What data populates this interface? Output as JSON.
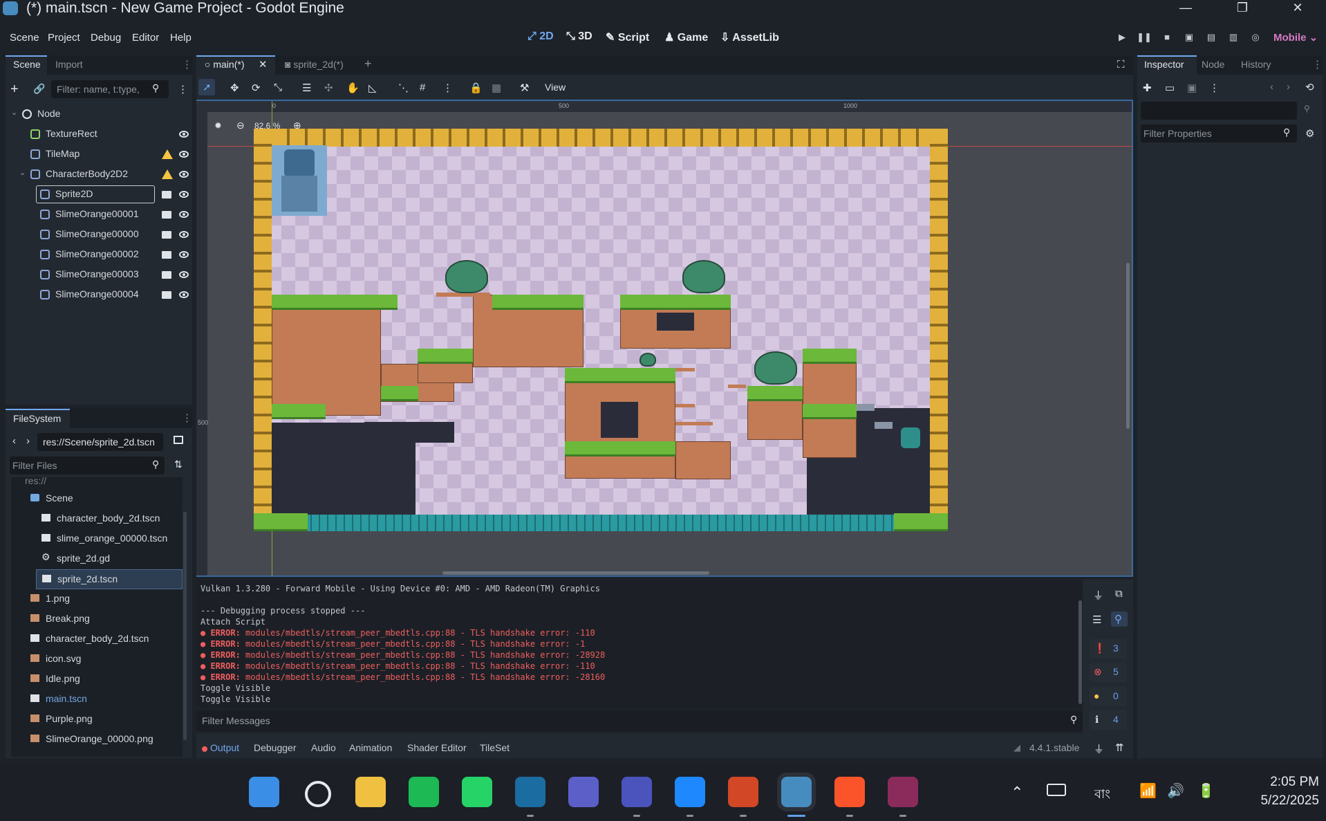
{
  "window": {
    "title": "(*) main.tscn - New Game Project - Godot Engine"
  },
  "menu": [
    "Scene",
    "Project",
    "Debug",
    "Editor",
    "Help"
  ],
  "workspaces": [
    {
      "label": "2D",
      "active": true
    },
    {
      "label": "3D",
      "active": false
    },
    {
      "label": "Script",
      "active": false
    },
    {
      "label": "Game",
      "active": false
    },
    {
      "label": "AssetLib",
      "active": false
    }
  ],
  "renderer": "Mobile",
  "scene_dock": {
    "tabs": [
      "Scene",
      "Import"
    ],
    "filter_placeholder": "Filter: name, t:type,",
    "nodes": [
      {
        "label": "Node",
        "icon": "node-icon"
      },
      {
        "label": "TextureRect",
        "icon": "texture-rect-icon"
      },
      {
        "label": "TileMap",
        "icon": "tilemap-icon",
        "warning": true
      },
      {
        "label": "CharacterBody2D2",
        "icon": "character-body-icon",
        "warning": true
      },
      {
        "label": "Sprite2D",
        "icon": "sprite-icon"
      },
      {
        "label": "SlimeOrange00001",
        "icon": "sprite-icon"
      },
      {
        "label": "SlimeOrange00000",
        "icon": "sprite-icon"
      },
      {
        "label": "SlimeOrange00002",
        "icon": "sprite-icon"
      },
      {
        "label": "SlimeOrange00003",
        "icon": "sprite-icon"
      },
      {
        "label": "SlimeOrange00004",
        "icon": "sprite-icon"
      }
    ]
  },
  "filesystem": {
    "title": "FileSystem",
    "path": "res://Scene/sprite_2d.tscn",
    "filter_placeholder": "Filter Files",
    "root": "res://",
    "items": [
      {
        "label": "Scene",
        "type": "folder"
      },
      {
        "label": "character_body_2d.tscn",
        "type": "scene"
      },
      {
        "label": "slime_orange_00000.tscn",
        "type": "scene"
      },
      {
        "label": "sprite_2d.gd",
        "type": "script"
      },
      {
        "label": "sprite_2d.tscn",
        "type": "scene",
        "selected": true
      },
      {
        "label": "1.png",
        "type": "image"
      },
      {
        "label": "Break.png",
        "type": "image"
      },
      {
        "label": "character_body_2d.tscn",
        "type": "scene"
      },
      {
        "label": "icon.svg",
        "type": "image"
      },
      {
        "label": "Idle.png",
        "type": "image"
      },
      {
        "label": "main.tscn",
        "type": "scene",
        "highlight": true
      },
      {
        "label": "Purple.png",
        "type": "image"
      },
      {
        "label": "SlimeOrange_00000.png",
        "type": "image"
      }
    ]
  },
  "editor": {
    "tabs": [
      {
        "label": "main(*)",
        "active": true
      },
      {
        "label": "sprite_2d(*)",
        "active": false
      }
    ],
    "toolbar_view": "View",
    "zoom": "82.6 %",
    "ruler_marks": [
      "0",
      "500",
      "1000"
    ],
    "ruler_v_mark": "500"
  },
  "inspector": {
    "tabs": [
      "Inspector",
      "Node",
      "History"
    ],
    "filter_placeholder": "Filter Properties"
  },
  "output": {
    "lines": [
      {
        "text": "Vulkan 1.3.280 - Forward Mobile - Using Device #0: AMD - AMD Radeon(TM) Graphics",
        "kind": "info"
      },
      {
        "text": "",
        "kind": "info"
      },
      {
        "text": "--- Debugging process stopped ---",
        "kind": "info"
      },
      {
        "text": "Attach Script",
        "kind": "info"
      },
      {
        "text": "modules/mbedtls/stream_peer_mbedtls.cpp:88 - TLS handshake error: -110",
        "kind": "error"
      },
      {
        "text": "modules/mbedtls/stream_peer_mbedtls.cpp:88 - TLS handshake error: -1",
        "kind": "error"
      },
      {
        "text": "modules/mbedtls/stream_peer_mbedtls.cpp:88 - TLS handshake error: -28928",
        "kind": "error"
      },
      {
        "text": "modules/mbedtls/stream_peer_mbedtls.cpp:88 - TLS handshake error: -110",
        "kind": "error"
      },
      {
        "text": "modules/mbedtls/stream_peer_mbedtls.cpp:88 - TLS handshake error: -28160",
        "kind": "error"
      },
      {
        "text": "Toggle Visible",
        "kind": "info"
      },
      {
        "text": "Toggle Visible",
        "kind": "info"
      }
    ],
    "error_prefix": "ERROR:",
    "filter_placeholder": "Filter Messages",
    "counts": {
      "messages": "3",
      "errors": "5",
      "warnings": "0",
      "info": "4"
    }
  },
  "bottom_tabs": [
    "Output",
    "Debugger",
    "Audio",
    "Animation",
    "Shader Editor",
    "TileSet"
  ],
  "version": "4.4.1.stable",
  "taskbar": {
    "apps": [
      "windows-start",
      "search",
      "file-explorer",
      "spotify",
      "whatsapp",
      "steam",
      "teams",
      "teams-work",
      "messenger",
      "powerpoint",
      "godot",
      "brave",
      "winrar"
    ],
    "language": "বাং",
    "time": "2:05 PM",
    "date": "5/22/2025"
  },
  "colors": {
    "accent": "#70a8f0",
    "error": "#ef5e5e",
    "warning": "#f5c543",
    "godot": "#478cbf"
  }
}
